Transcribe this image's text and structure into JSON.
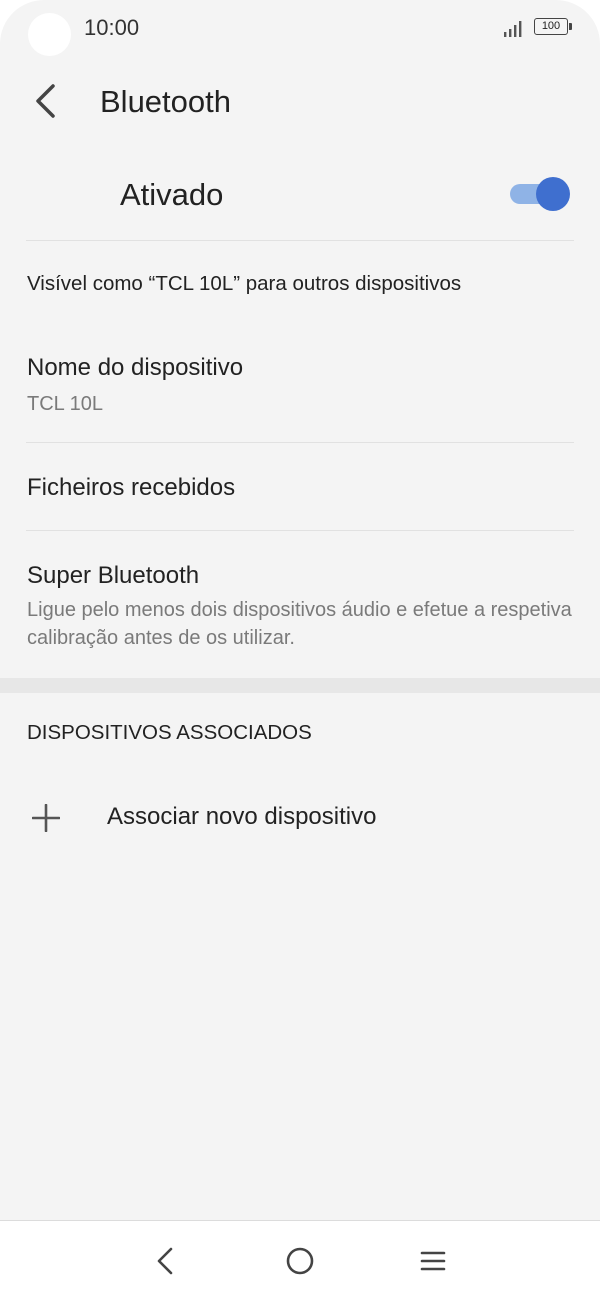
{
  "status_bar": {
    "time": "10:00",
    "battery_level": "100",
    "icons": [
      "camera-cutout",
      "signal-icon",
      "battery-icon"
    ]
  },
  "app_bar": {
    "title": "Bluetooth",
    "back_icon": "chevron-left-icon"
  },
  "bluetooth_toggle": {
    "label": "Ativado",
    "on": true,
    "accent_color": "#3f6fcf",
    "track_color": "#8fb3e6"
  },
  "visibility_text": "Visível como “TCL 10L” para outros dispositivos",
  "settings": [
    {
      "title": "Nome do dispositivo",
      "subtitle": "TCL 10L"
    },
    {
      "title": "Ficheiros recebidos",
      "subtitle": ""
    },
    {
      "title": "Super Bluetooth",
      "subtitle": "Ligue pelo menos dois dispositivos áudio e efetue a respetiva calibração antes de os utilizar."
    }
  ],
  "paired_section": {
    "header": "DISPOSITIVOS ASSOCIADOS",
    "add_label": "Associar novo dispositivo",
    "add_icon": "plus-icon"
  },
  "nav_bar": {
    "buttons": [
      "back-icon",
      "home-icon",
      "menu-icon"
    ]
  }
}
